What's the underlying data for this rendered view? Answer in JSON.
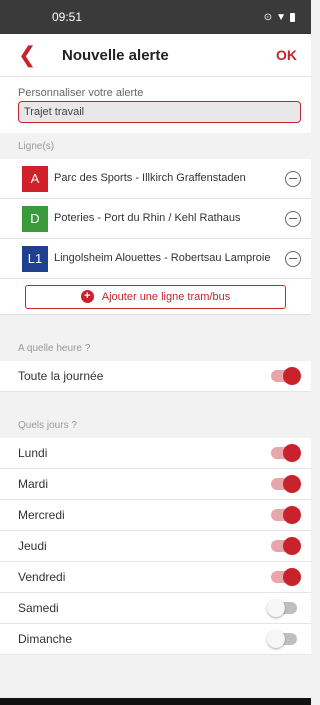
{
  "status_bar": {
    "time": "09:51",
    "icons": [
      "vpn-key-icon",
      "wifi-icon",
      "battery-icon"
    ]
  },
  "header": {
    "back_icon": "chevron-left-icon",
    "title": "Nouvelle alerte",
    "ok_label": "OK"
  },
  "custom": {
    "label": "Personnaliser votre alerte",
    "value": "Trajet travail"
  },
  "lines": {
    "section_label": "Ligne(s)",
    "items": [
      {
        "badge": "A",
        "color": "#d0202a",
        "name": "Parc des Sports - Illkirch Graffenstaden"
      },
      {
        "badge": "D",
        "color": "#3a9a3a",
        "name": "Poteries - Port du Rhin / Kehl Rathaus"
      },
      {
        "badge": "L1",
        "color": "#1f3f8f",
        "name": "Lingolsheim Alouettes - Robertsau Lamproie"
      }
    ],
    "add_label": "Ajouter une ligne tram/bus"
  },
  "time_section": {
    "label": "A quelle heure ?",
    "all_day_label": "Toute la journée",
    "all_day_on": true
  },
  "days_section": {
    "label": "Quels jours ?",
    "days": [
      {
        "label": "Lundi",
        "on": true
      },
      {
        "label": "Mardi",
        "on": true
      },
      {
        "label": "Mercredi",
        "on": true
      },
      {
        "label": "Jeudi",
        "on": true
      },
      {
        "label": "Vendredi",
        "on": true
      },
      {
        "label": "Samedi",
        "on": false
      },
      {
        "label": "Dimanche",
        "on": false
      }
    ]
  },
  "colors": {
    "accent": "#c8232d",
    "background": "#f2f2f2",
    "status_bar": "#3a3a3a"
  }
}
